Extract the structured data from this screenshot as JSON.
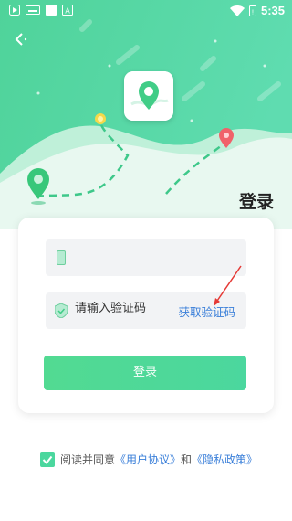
{
  "status_bar": {
    "time": "5:35"
  },
  "login": {
    "title": "登录",
    "button_label": "登录"
  },
  "phone_field": {
    "placeholder": ""
  },
  "code_field": {
    "placeholder": "请输入验证码",
    "get_code_label": "获取验证码"
  },
  "agreement": {
    "prefix": "阅读并同意",
    "user_agreement": "《用户协议》",
    "conjunction": "和",
    "privacy_policy": "《隐私政策》",
    "checked": true
  },
  "colors": {
    "accent": "#4bd79e",
    "link": "#3a7fd9",
    "hero_top": "#5ad7a0",
    "hero_mountain": "#e6f7ef"
  },
  "icons": [
    "play-icon",
    "keyboard-icon",
    "square-icon",
    "a-icon",
    "wifi-icon",
    "battery-icon",
    "back-icon",
    "map-pin-app-icon",
    "phone-icon",
    "shield-icon",
    "check-icon"
  ]
}
